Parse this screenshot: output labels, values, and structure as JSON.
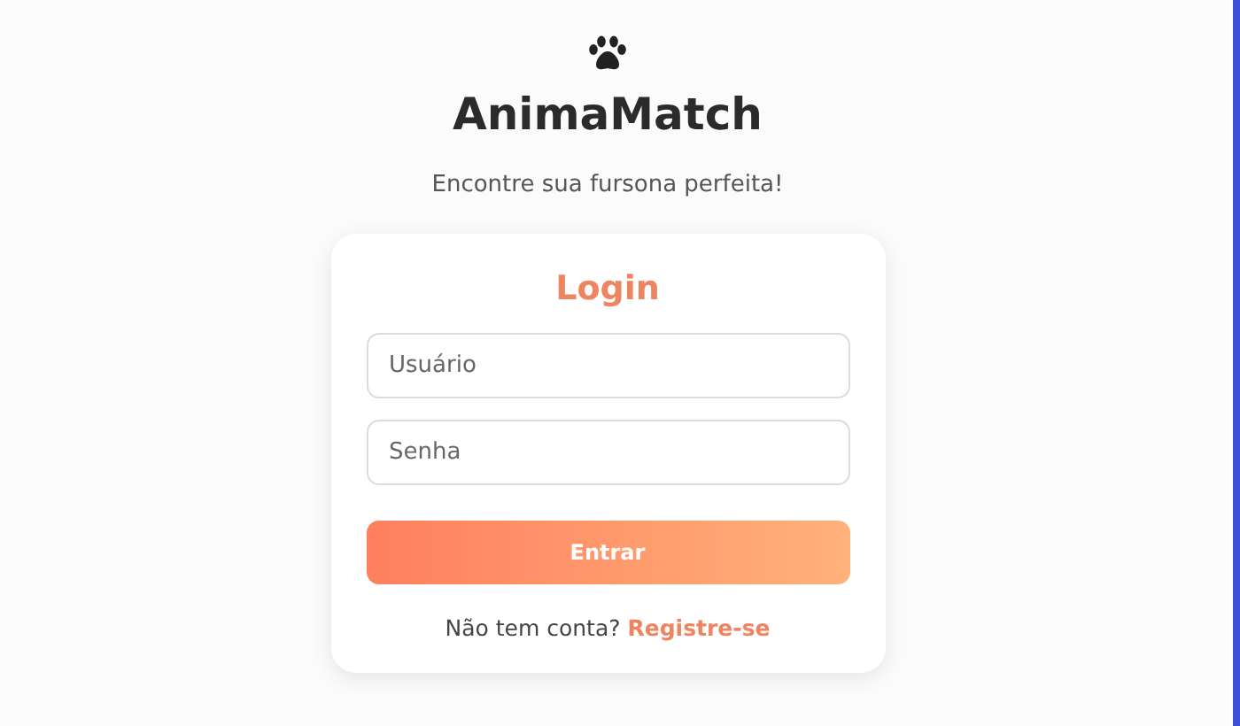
{
  "app": {
    "title": "AnimaMatch",
    "tagline": "Encontre sua fursona perfeita!"
  },
  "login": {
    "heading": "Login",
    "fields": [
      {
        "placeholder": "Usuário"
      },
      {
        "placeholder": "Senha"
      }
    ],
    "submit": "Entrar",
    "footer": {
      "text": "Não tem conta?",
      "link": "Registre-se"
    }
  }
}
